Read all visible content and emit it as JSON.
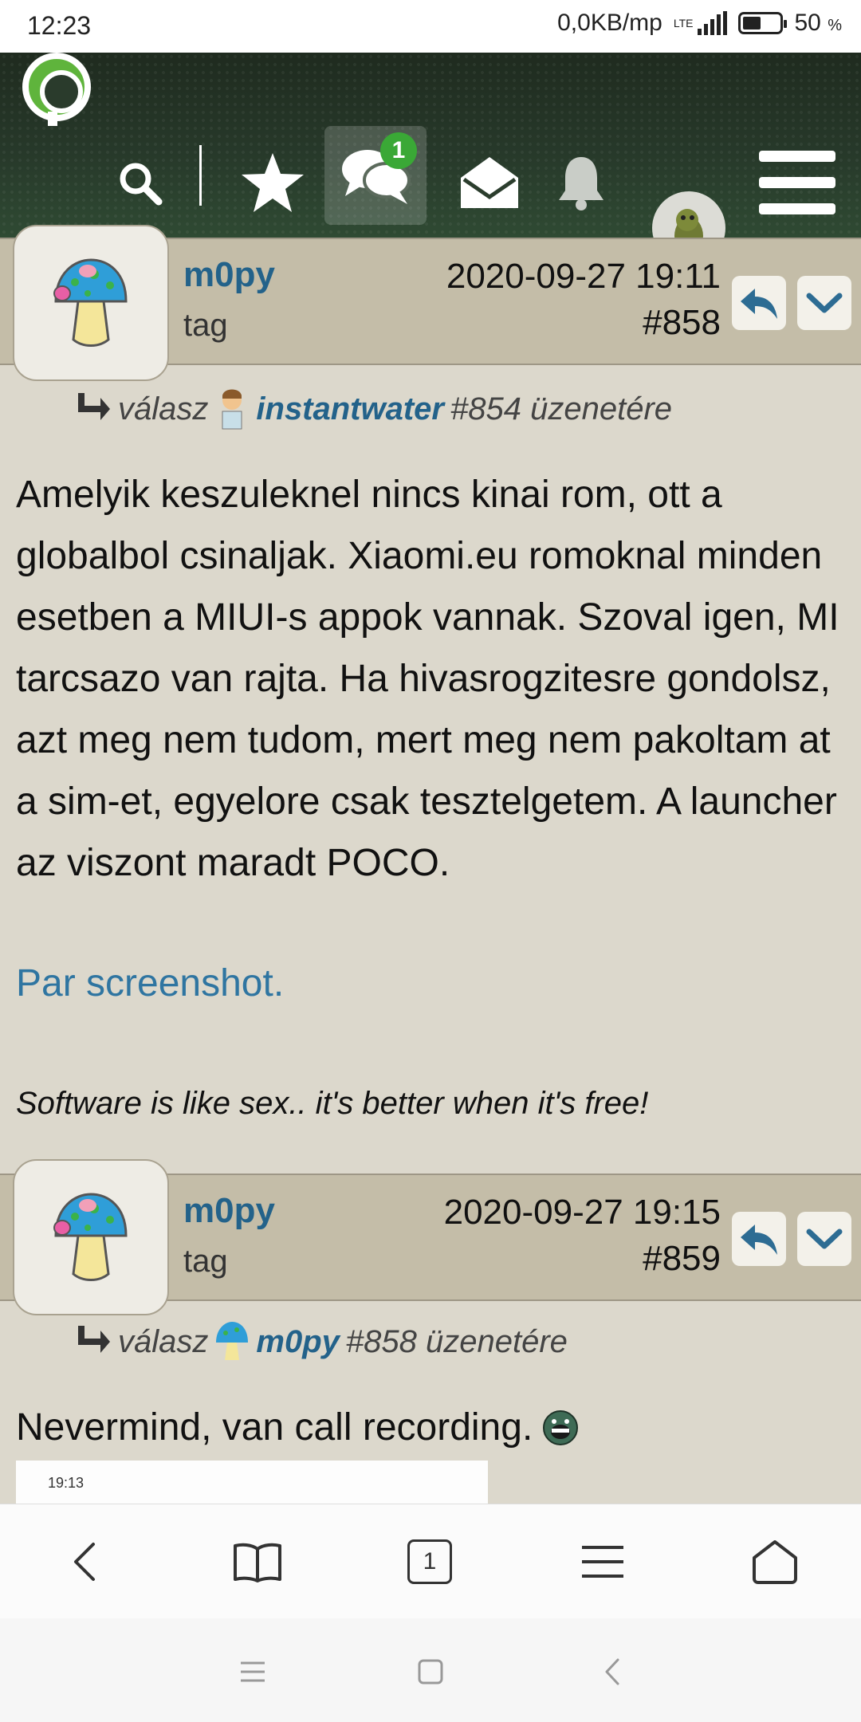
{
  "status_bar": {
    "time": "12:23",
    "network_speed": "0,0KB/mp",
    "network_type": "LTE",
    "battery_percent": "50",
    "battery_unit": "%"
  },
  "header": {
    "icons": [
      "search-icon",
      "star-icon",
      "chat-icon",
      "envelope-icon",
      "bell-icon",
      "avatar",
      "menu-icon"
    ],
    "chat_badge": "1"
  },
  "posts": [
    {
      "username": "m0py",
      "rank": "tag",
      "datetime": "2020-09-27 19:11",
      "number": "#858",
      "reply_prefix": "válasz",
      "reply_to_user": "instantwater",
      "reply_to_post": "#854 üzenetére",
      "body": "Amelyik keszuleknel nincs kinai rom, ott a globalbol csinaljak. Xiaomi.eu romoknal minden esetben a MIUI-s appok vannak. Szoval igen, MI tarcsazo van rajta. Ha hivasrogzitesre gondolsz, azt meg nem tudom, mert meg nem pakoltam at a sim-et, egyelore csak tesztelgetem. A launcher az viszont maradt POCO.",
      "link_text": "Par screenshot.",
      "signature": "Software is like sex.. it's better when it's free!"
    },
    {
      "username": "m0py",
      "rank": "tag",
      "datetime": "2020-09-27 19:15",
      "number": "#859",
      "reply_prefix": "válasz",
      "reply_to_user": "m0py",
      "reply_to_post": "#858 üzenetére",
      "body": "Nevermind, van call recording.",
      "embedded_screenshot_time": "19:13"
    }
  ],
  "browser_bar": {
    "tab_count": "1"
  },
  "colors": {
    "link": "#2f75a1",
    "username": "#23628a",
    "post_header_bg": "#c4bda8",
    "page_bg": "#dcd8cc",
    "badge": "#3aa836"
  }
}
